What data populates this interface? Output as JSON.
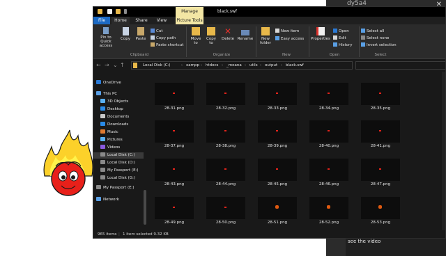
{
  "background_window": {
    "title": "dy5a4",
    "close": "✕",
    "video_text": "see the video"
  },
  "explorer": {
    "title": "black.swf",
    "manage_tab": "Manage",
    "tabs": [
      "File",
      "Home",
      "Share",
      "View",
      "Picture Tools"
    ],
    "ribbon": {
      "clipboard": {
        "pin": "Pin to Quick access",
        "copy": "Copy",
        "paste": "Paste",
        "cut": "Cut",
        "copy_path": "Copy path",
        "paste_shortcut": "Paste shortcut",
        "group": "Clipboard"
      },
      "organize": {
        "move_to": "Move to",
        "copy_to": "Copy to",
        "delete": "Delete",
        "rename": "Rename",
        "group": "Organize"
      },
      "new": {
        "new_folder": "New folder",
        "new_item": "New item",
        "easy_access": "Easy access",
        "group": "New"
      },
      "open": {
        "properties": "Properties",
        "open": "Open",
        "edit": "Edit",
        "history": "History",
        "group": "Open"
      },
      "select": {
        "select_all": "Select all",
        "select_none": "Select none",
        "invert": "Invert selection",
        "group": "Select"
      }
    },
    "address": {
      "back": "←",
      "forward": "→",
      "up_recent": "⌄",
      "up": "↑",
      "crumbs": [
        "Local Disk (C:)",
        "xampp",
        "htdocs",
        "_moana",
        "utils",
        "output",
        "black.swf"
      ]
    },
    "sidebar": [
      {
        "label": "OneDrive",
        "icon": "cloud-icon",
        "color": "#2a7ad6"
      },
      {
        "label": "This PC",
        "icon": "pc-icon",
        "color": "#5aa0e6"
      },
      {
        "label": "3D Objects",
        "icon": "cube-icon",
        "color": "#5ab0f0"
      },
      {
        "label": "Desktop",
        "icon": "desktop-icon",
        "color": "#2a8ae6"
      },
      {
        "label": "Documents",
        "icon": "document-icon",
        "color": "#c8c8c8"
      },
      {
        "label": "Downloads",
        "icon": "download-icon",
        "color": "#2a8ae6"
      },
      {
        "label": "Music",
        "icon": "music-icon",
        "color": "#e07a30"
      },
      {
        "label": "Pictures",
        "icon": "pictures-icon",
        "color": "#5ab0f0"
      },
      {
        "label": "Videos",
        "icon": "video-icon",
        "color": "#8a5ae0"
      },
      {
        "label": "Local Disk (C:)",
        "icon": "drive-icon",
        "color": "#8a8a8a",
        "selected": true
      },
      {
        "label": "Local Disk (D:)",
        "icon": "drive-icon",
        "color": "#8a8a8a"
      },
      {
        "label": "My Passport (E:)",
        "icon": "drive-icon",
        "color": "#8a8a8a"
      },
      {
        "label": "Local Disk (G:)",
        "icon": "drive-icon",
        "color": "#8a8a8a"
      },
      {
        "label": "My Passport (E:)",
        "icon": "drive-icon",
        "color": "#8a8a8a"
      },
      {
        "label": "Network",
        "icon": "network-icon",
        "color": "#5aa0e6"
      }
    ],
    "files": [
      {
        "name": "28-31.png",
        "mark": "dot"
      },
      {
        "name": "28-32.png",
        "mark": "dot"
      },
      {
        "name": "28-33.png",
        "mark": "dot"
      },
      {
        "name": "28-34.png",
        "mark": "dot"
      },
      {
        "name": "28-35.png",
        "mark": "dot"
      },
      {
        "name": "28-37.png",
        "mark": "dot"
      },
      {
        "name": "28-38.png",
        "mark": "dot"
      },
      {
        "name": "28-39.png",
        "mark": "dot"
      },
      {
        "name": "28-40.png",
        "mark": "dot"
      },
      {
        "name": "28-41.png",
        "mark": "dot"
      },
      {
        "name": "28-43.png",
        "mark": "dot"
      },
      {
        "name": "28-44.png",
        "mark": "dot"
      },
      {
        "name": "28-45.png",
        "mark": "dot"
      },
      {
        "name": "28-46.png",
        "mark": "dot"
      },
      {
        "name": "28-47.png",
        "mark": "dot"
      },
      {
        "name": "28-49.png",
        "mark": "dot"
      },
      {
        "name": "28-50.png",
        "mark": "dot"
      },
      {
        "name": "28-51.png",
        "mark": "big"
      },
      {
        "name": "28-52.png",
        "mark": "big"
      },
      {
        "name": "28-53.png",
        "mark": "big"
      }
    ],
    "status": {
      "items": "965 items",
      "selected": "1 item selected  9.32 KB"
    }
  }
}
